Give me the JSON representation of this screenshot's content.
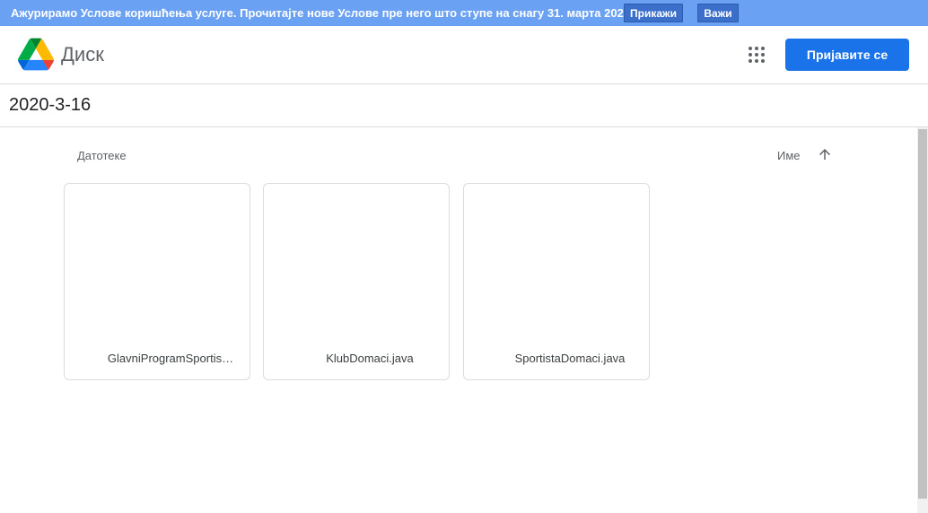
{
  "notice": {
    "text": "Ажурирамо Услове коришћења услуге. Прочитајте нове Услове пре него што ступе на снагу 31. марта 2020.",
    "show_label": "Прикажи",
    "dismiss_label": "Важи"
  },
  "header": {
    "brand": "Диск",
    "signin_label": "Пријавите се",
    "apps_icon": "apps-grid-icon",
    "logo_icon": "google-drive-logo"
  },
  "folder": {
    "title": "2020-3-16"
  },
  "files_section": {
    "label": "Датотеке",
    "sort_label": "Име",
    "sort_icon": "arrow-up-icon"
  },
  "files": [
    {
      "name": "GlavniProgramSportis…"
    },
    {
      "name": "KlubDomaci.java"
    },
    {
      "name": "SportistaDomaci.java"
    }
  ],
  "colors": {
    "notice_bg": "#6aa1f2",
    "accent": "#1a73e8"
  }
}
